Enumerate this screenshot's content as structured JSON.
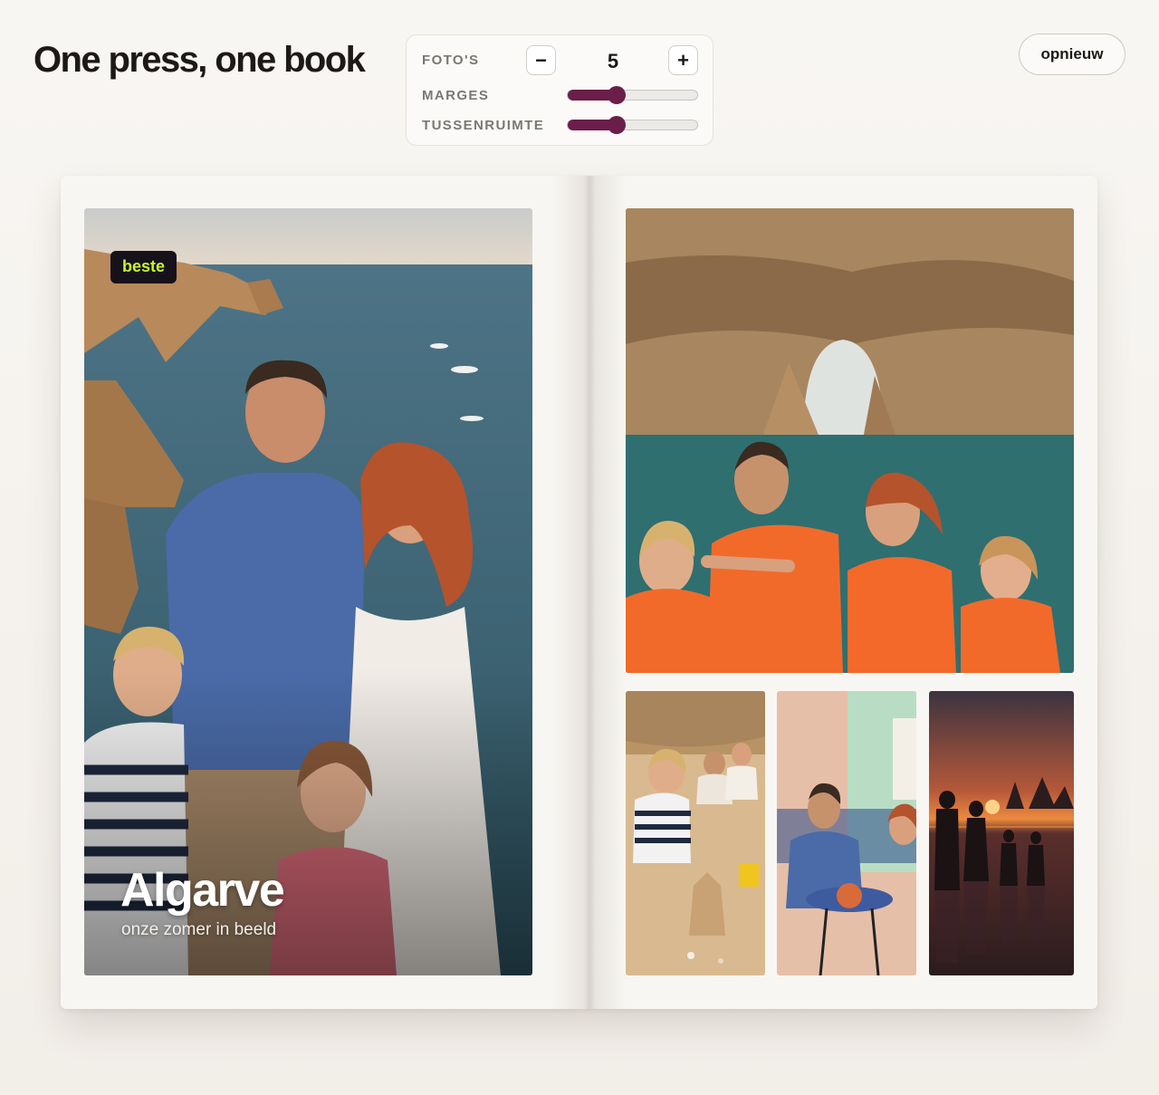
{
  "app": {
    "title": "One press, one book"
  },
  "controls": {
    "photos": {
      "label": "FOTO'S",
      "value": "5",
      "minus": "−",
      "plus": "+"
    },
    "margins": {
      "label": "MARGES",
      "level": 0.38
    },
    "spacing": {
      "label": "TUSSENRUIMTE",
      "level": 0.38
    },
    "accent_color": "#6b1e4a"
  },
  "reset_button": {
    "label": "opnieuw"
  },
  "book": {
    "cover": {
      "badge": "beste",
      "title": "Algarve",
      "subtitle": "onze zomer in beeld",
      "image": "family-portrait-coastal-cliffs-sunset"
    },
    "photos": [
      {
        "image": "family-boat-trip-sea-arch-life-jackets"
      },
      {
        "image": "kids-building-sandcastle-beach"
      },
      {
        "image": "family-dinner-outdoor-terrace"
      },
      {
        "image": "family-silhouette-sunset-beach"
      }
    ]
  }
}
